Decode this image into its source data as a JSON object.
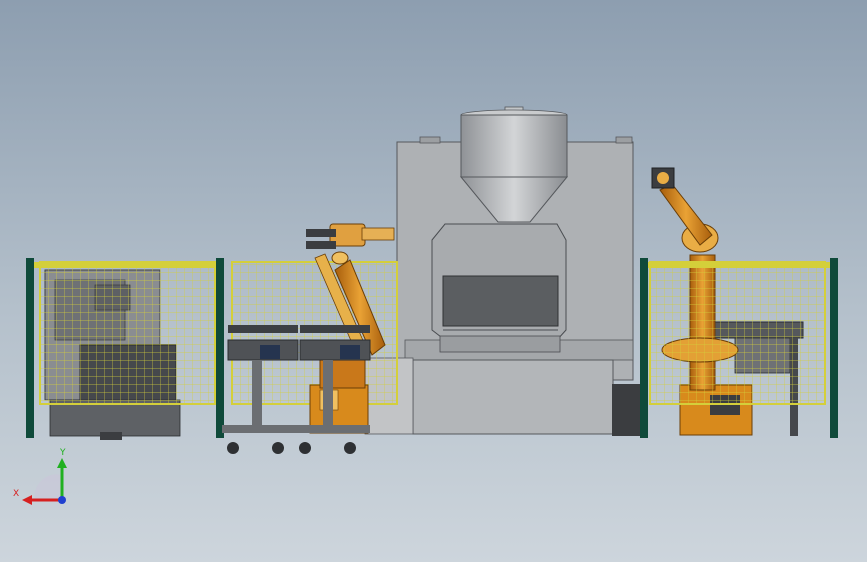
{
  "viewport": {
    "background_top": "#8d9eb0",
    "background_bottom": "#cdd5dc"
  },
  "triad": {
    "x_label": "X",
    "y_label": "Y",
    "x_color": "#d62020",
    "y_color": "#20b020",
    "z_color": "#2040d0"
  },
  "colors": {
    "fence_post": "#0f4a3a",
    "fence_mesh": "#d8d040",
    "machine_body": "#b0b3b6",
    "robot": "#d88a1c",
    "dark": "#3b3d40"
  }
}
